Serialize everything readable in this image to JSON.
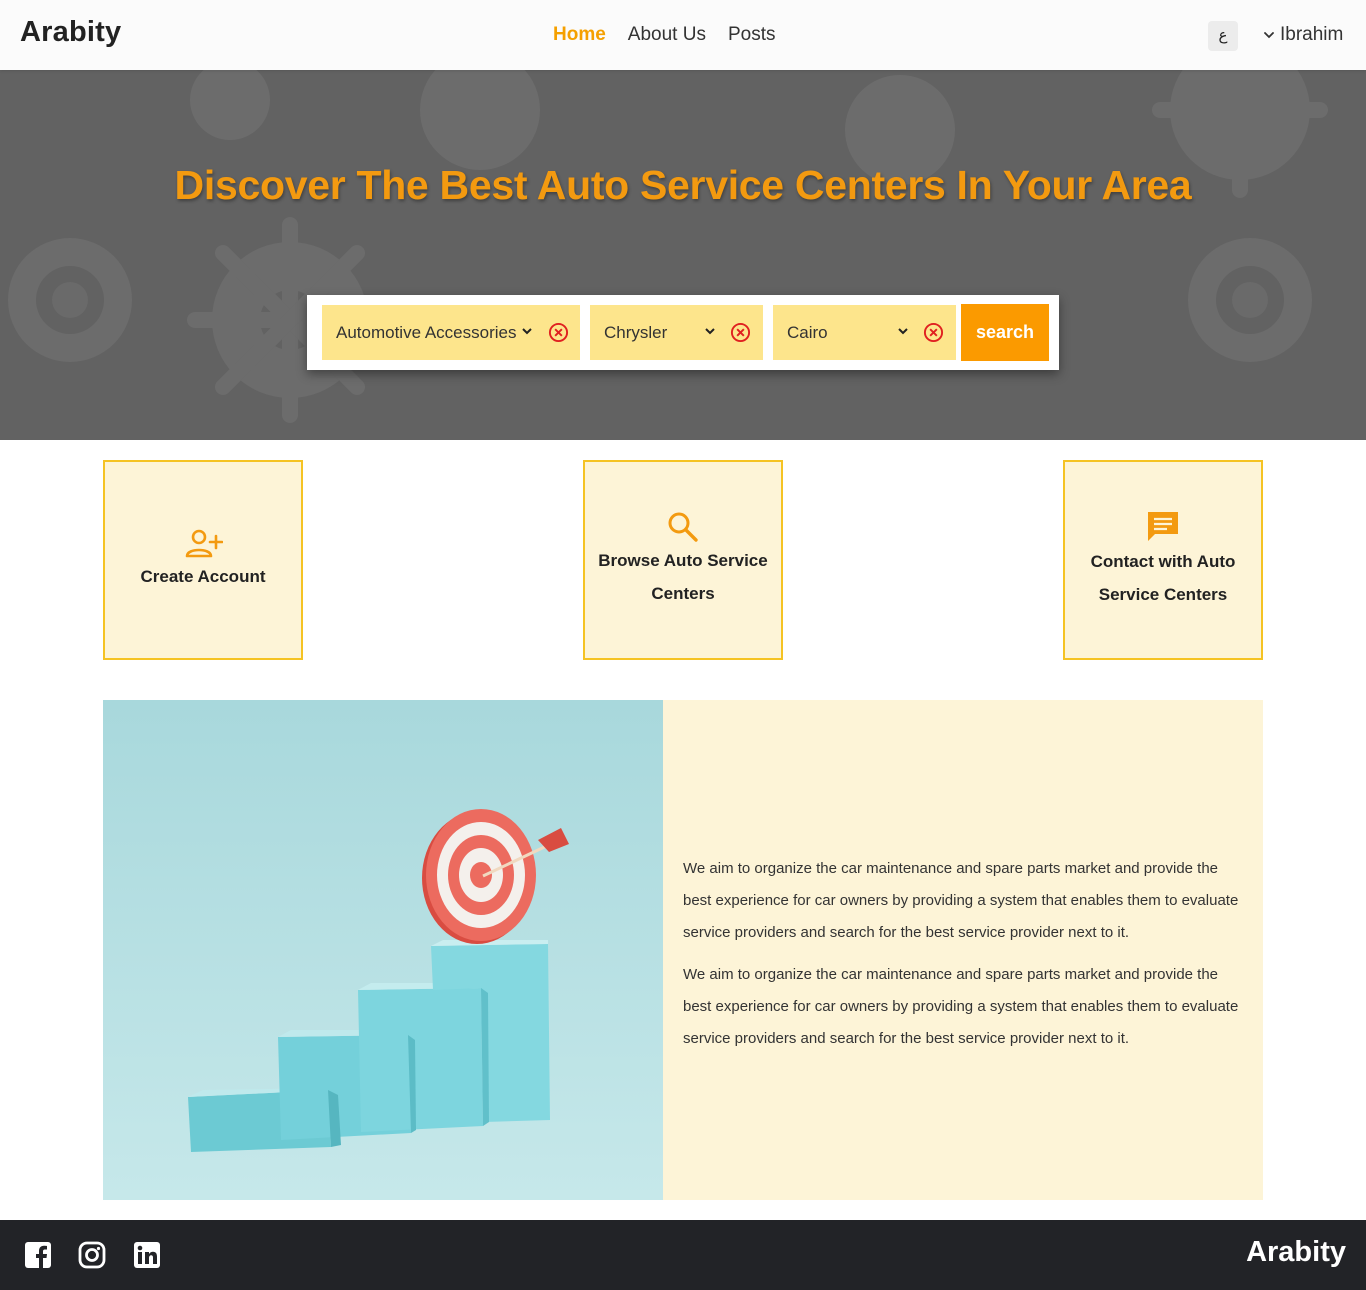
{
  "header": {
    "brand": "Arabity",
    "nav": [
      {
        "label": "Home",
        "active": true
      },
      {
        "label": "About Us",
        "active": false
      },
      {
        "label": "Posts",
        "active": false
      }
    ],
    "language_toggle": "ع",
    "user_name": "Ibrahim"
  },
  "hero": {
    "title": "Discover The Best Auto Service Centers In Your Area",
    "filters": {
      "category": "Automotive Accessories",
      "brand": "Chrysler",
      "city": "Cairo"
    },
    "search_label": "search"
  },
  "features": [
    {
      "icon": "person-add-icon",
      "title": "Create Account"
    },
    {
      "icon": "search-icon",
      "title": "Browse Auto Service Centers"
    },
    {
      "icon": "chat-icon",
      "title": "Contact with Auto Service Centers"
    }
  ],
  "about": {
    "paragraphs": [
      "We aim to organize the car maintenance and spare parts market and provide the best experience for car owners by providing a system that enables them to evaluate service providers and search for the best service provider next to it.",
      "We aim to organize the car maintenance and spare parts market and provide the best experience for car owners by providing a system that enables them to evaluate service providers and search for the best service provider next to it."
    ],
    "image_icon": "target-growth-illustration"
  },
  "footer": {
    "social": [
      "facebook-icon",
      "instagram-icon",
      "linkedin-icon"
    ],
    "brand": "Arabity"
  },
  "colors": {
    "accent": "#f5a000",
    "button": "#fb9a00",
    "select_bg": "#fde58c",
    "card_bg": "#fdf4d7",
    "card_border": "#f5c323",
    "hero_bg": "#626262",
    "footer_bg": "#222327",
    "clear_icon": "#e02020"
  }
}
